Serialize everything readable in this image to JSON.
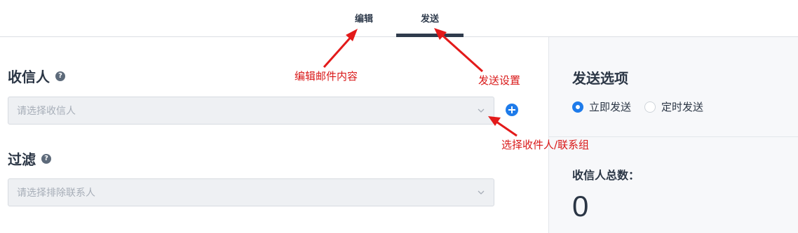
{
  "tabs": [
    {
      "label": "编辑"
    },
    {
      "label": "发送"
    }
  ],
  "recipients": {
    "title": "收信人",
    "help_icon": "?",
    "placeholder": "请选择收信人"
  },
  "filter": {
    "title": "过滤",
    "help_icon": "?",
    "placeholder": "请选择排除联系人"
  },
  "send_options": {
    "title": "发送选项",
    "options": [
      {
        "label": "立即发送",
        "checked": true
      },
      {
        "label": "定时发送",
        "checked": false
      }
    ]
  },
  "totals": {
    "label": "收信人总数：",
    "count": "0"
  },
  "annotations": {
    "edit_content": "编辑邮件内容",
    "send_settings": "发送设置",
    "select_recipients": "选择收件人/联系组"
  },
  "colors": {
    "accent": "#1e7bea",
    "annotation": "#d91818",
    "text_dark": "#2b3645"
  },
  "icons": [
    "question-icon",
    "chevron-down-icon",
    "add-icon"
  ]
}
